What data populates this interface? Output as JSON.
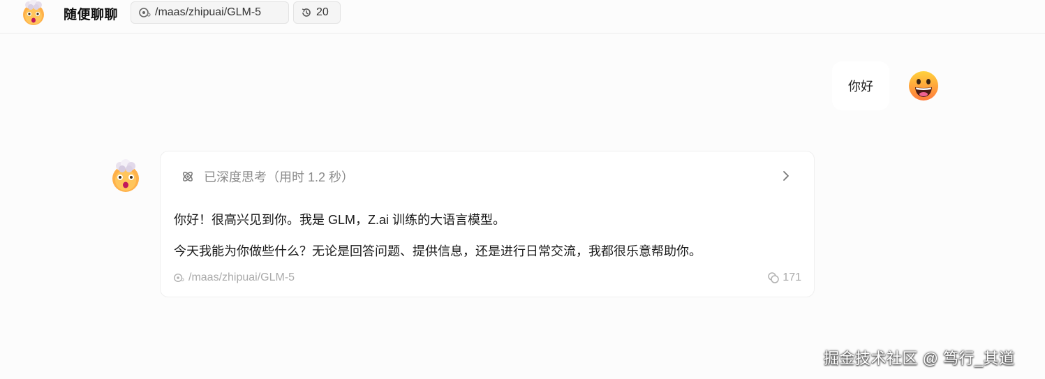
{
  "header": {
    "title": "随便聊聊",
    "model_chip": "/maas/zhipuai/GLM-5",
    "history_count": "20"
  },
  "conversation": {
    "user_message": "你好",
    "assistant": {
      "thinking_label": "已深度思考（用时 1.2 秒）",
      "lines": [
        "你好！很高兴见到你。我是 GLM，Z.ai 训练的大语言模型。",
        "今天我能为你做些什么？无论是回答问题、提供信息，还是进行日常交流，我都很乐意帮助你。"
      ],
      "model": "/maas/zhipuai/GLM-5",
      "token_count": "171"
    }
  },
  "watermark": "掘金技术社区 @ 笃行_其道",
  "icons": {
    "assistant_avatar": "mind-blown-emoji-icon",
    "user_avatar": "grinning-emoji-icon",
    "model": "model-icon",
    "history": "history-icon",
    "thinking": "atom-icon",
    "expand": "chevron-right-icon",
    "tokens": "coins-icon"
  }
}
